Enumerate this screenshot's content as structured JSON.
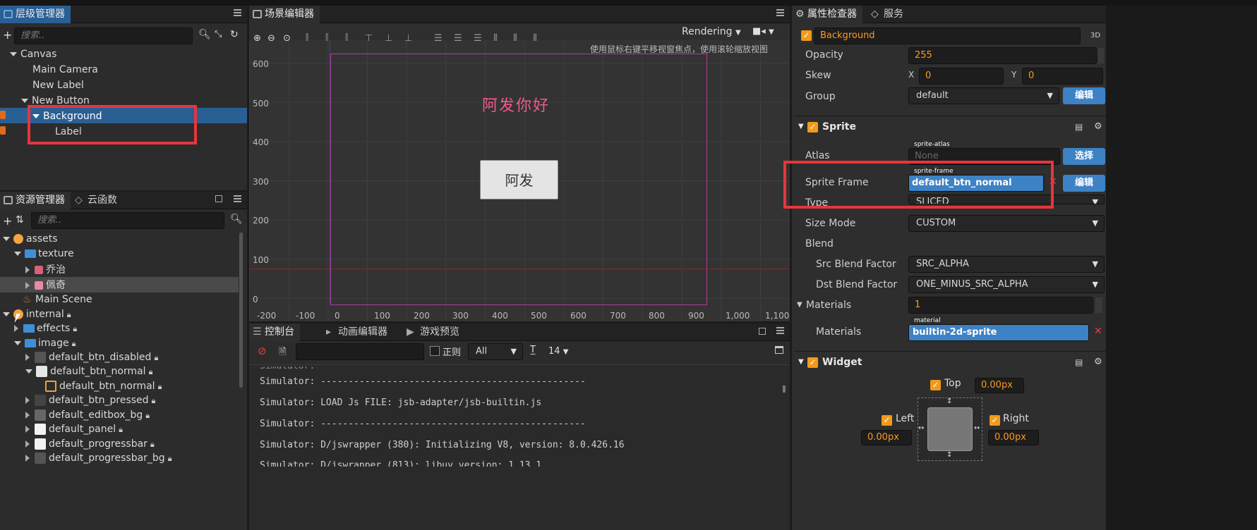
{
  "hierarchy": {
    "tab": "层级管理器",
    "search_placeholder": "搜索..",
    "nodes": [
      "Canvas",
      "Main Camera",
      "New Label",
      "New Button",
      "Background",
      "Label"
    ]
  },
  "assets": {
    "tab": "资源管理器",
    "tab2": "云函数",
    "search_placeholder": "搜索..",
    "items": {
      "assets": "assets",
      "texture": "texture",
      "qiaozhi": "乔治",
      "peiqi": "佩奇",
      "main_scene": "Main Scene",
      "internal": "internal",
      "effects": "effects",
      "image": "image",
      "btn_disabled": "default_btn_disabled",
      "btn_normal": "default_btn_normal",
      "btn_normal_sub": "default_btn_normal",
      "btn_pressed": "default_btn_pressed",
      "editbox": "default_editbox_bg",
      "panel": "default_panel",
      "progressbar": "default_progressbar",
      "progressbar_bg": "default_progressbar_bg"
    }
  },
  "scene": {
    "tab": "场景编辑器",
    "rendering": "Rendering",
    "hint": "使用鼠标右键平移视窗焦点，使用滚轮缩放视图",
    "canvas_text": "阿发你好",
    "button_text": "阿发",
    "y_ticks": [
      "600",
      "500",
      "400",
      "300",
      "200",
      "100",
      "0"
    ],
    "x_ticks": [
      "-200",
      "-100",
      "0",
      "100",
      "200",
      "300",
      "400",
      "500",
      "600",
      "700",
      "800",
      "900",
      "1,000",
      "1,100"
    ]
  },
  "console": {
    "tabs": [
      "控制台",
      "动画编辑器",
      "游戏预览"
    ],
    "regex_label": "正则",
    "level": "All",
    "font_size": "14",
    "lines": [
      "Simulator: ------------------------------------------------",
      "Simulator: LOAD Js FILE: jsb-adapter/jsb-builtin.js",
      "Simulator: ------------------------------------------------",
      "Simulator: D/jswrapper (380): Initializing V8, version: 8.0.426.16"
    ],
    "partial_bottom": "Simulator: D/jswrapper (813): libuv version: 1.13.1"
  },
  "inspector": {
    "tab": "属性检查器",
    "tab2": "服务",
    "node_name": "Background",
    "badge_3d": "3D",
    "opacity_label": "Opacity",
    "opacity": "255",
    "skew_label": "Skew",
    "skew_x_label": "X",
    "skew_x": "0",
    "skew_y_label": "Y",
    "skew_y": "0",
    "group_label": "Group",
    "group": "default",
    "edit_btn": "编辑",
    "sprite": {
      "title": "Sprite",
      "atlas_tag": "sprite-atlas",
      "atlas_label": "Atlas",
      "atlas_value": "None",
      "select_btn": "选择",
      "frame_tag": "sprite-frame",
      "frame_label": "Sprite Frame",
      "frame_value": "default_btn_normal",
      "edit_btn": "编辑",
      "type_label": "Type",
      "type_value": "SLICED",
      "size_mode_label": "Size Mode",
      "size_mode": "CUSTOM",
      "blend_label": "Blend",
      "src_label": "Src Blend Factor",
      "src_value": "SRC_ALPHA",
      "dst_label": "Dst Blend Factor",
      "dst_value": "ONE_MINUS_SRC_ALPHA",
      "materials_title": "Materials",
      "materials_count": "1",
      "material_tag": "material",
      "materials_label": "Materials",
      "material_value": "builtin-2d-sprite"
    },
    "widget": {
      "title": "Widget",
      "top_label": "Top",
      "top_value": "0.00px",
      "left_label": "Left",
      "left_value": "0.00px",
      "right_label": "Right",
      "right_value": "0.00px"
    }
  },
  "colors": {
    "accent_blue": "#3d82c4",
    "check_orange": "#f29a1a",
    "highlight_red": "#e8353c",
    "canvas_pink": "#c43a9a"
  }
}
